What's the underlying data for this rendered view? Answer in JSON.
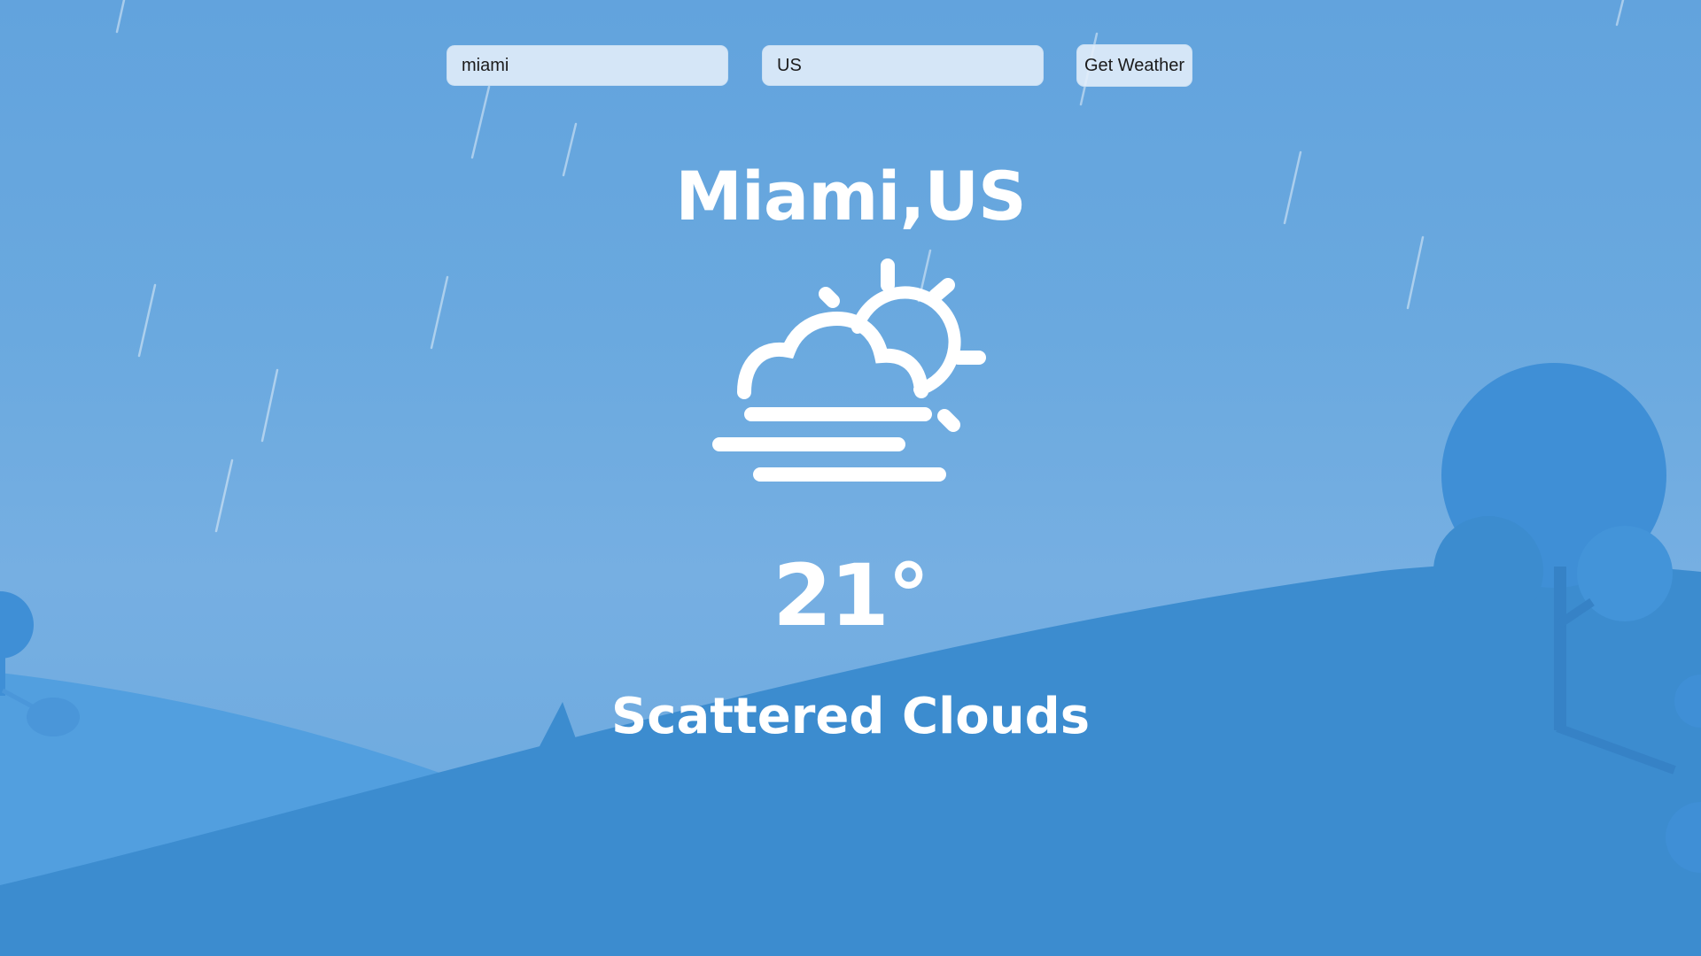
{
  "search": {
    "city_value": "miami",
    "country_value": "US",
    "button_label": "Get Weather"
  },
  "weather": {
    "location": "Miami,US",
    "temperature": "21°",
    "description": "Scattered Clouds",
    "icon": "partly-cloudy-fog-icon"
  },
  "colors": {
    "sky": "#6aa9df",
    "hill_front": "#3c8ccf",
    "hill_back": "#529fdf",
    "tree": "#3f8fd6",
    "text": "#ffffff"
  }
}
